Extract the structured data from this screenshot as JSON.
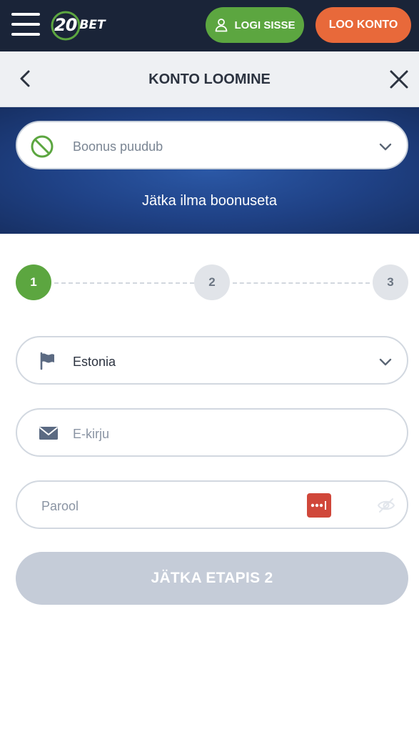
{
  "topbar": {
    "logo_number": "20",
    "logo_text": "BET",
    "login_label": "LOGI SISSE",
    "register_label": "LOO KONTO"
  },
  "header": {
    "title": "KONTO LOOMINE"
  },
  "bonus": {
    "selected": "Boonus puudub",
    "note": "Jätka ilma boonuseta"
  },
  "stepper": {
    "steps": [
      "1",
      "2",
      "3"
    ],
    "active_step": 1
  },
  "form": {
    "country": "Estonia",
    "email_placeholder": "E-kirju",
    "password_placeholder": "Parool"
  },
  "continue_label": "JÄTKA ETAPIS 2",
  "colors": {
    "topbar_bg": "#1a2438",
    "green": "#5ca640",
    "orange": "#e8693a",
    "banner_blue": "#1f4185",
    "disabled_button": "#c5ccd8"
  },
  "icons": {
    "menu": "hamburger-menu-icon",
    "login": "user-icon",
    "back": "chevron-left-icon",
    "close": "close-icon",
    "no_bonus": "prohibited-icon",
    "dropdown": "chevron-down-icon",
    "country": "flag-icon",
    "email": "envelope-icon",
    "password_manager": "password-dots-icon",
    "visibility": "eye-hidden-icon"
  }
}
